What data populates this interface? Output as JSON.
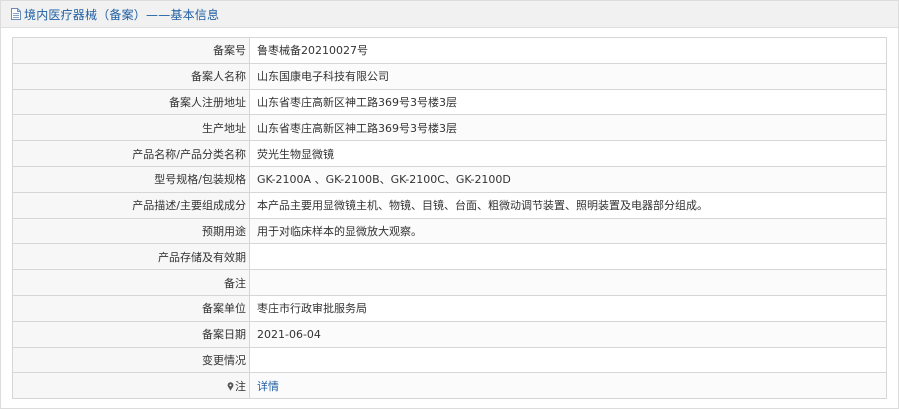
{
  "header": {
    "title": "境内医疗器械（备案）——基本信息",
    "icon": "document-icon"
  },
  "colors": {
    "title_text": "#1f5fa3",
    "header_bg": "#f1f1f1",
    "label_bg": "#f7f7f7",
    "border": "#d6d6d6"
  },
  "rows": [
    {
      "label": "备案号",
      "value": "鲁枣械备20210027号"
    },
    {
      "label": "备案人名称",
      "value": "山东国康电子科技有限公司"
    },
    {
      "label": "备案人注册地址",
      "value": "山东省枣庄高新区神工路369号3号楼3层"
    },
    {
      "label": "生产地址",
      "value": "山东省枣庄高新区神工路369号3号楼3层"
    },
    {
      "label": "产品名称/产品分类名称",
      "value": "荧光生物显微镜"
    },
    {
      "label": "型号规格/包装规格",
      "value": "GK-2100A 、GK-2100B、GK-2100C、GK-2100D"
    },
    {
      "label": "产品描述/主要组成成分",
      "value": "本产品主要用显微镜主机、物镜、目镜、台面、粗微动调节装置、照明装置及电器部分组成。"
    },
    {
      "label": "预期用途",
      "value": "用于对临床样本的显微放大观察。"
    },
    {
      "label": "产品存储及有效期",
      "value": ""
    },
    {
      "label": "备注",
      "value": ""
    },
    {
      "label": "备案单位",
      "value": "枣庄市行政审批服务局"
    },
    {
      "label": "备案日期",
      "value": "2021-06-04"
    },
    {
      "label": "变更情况",
      "value": ""
    }
  ],
  "note_row": {
    "label": "注",
    "icon": "pin-icon",
    "link_text": "详情"
  }
}
